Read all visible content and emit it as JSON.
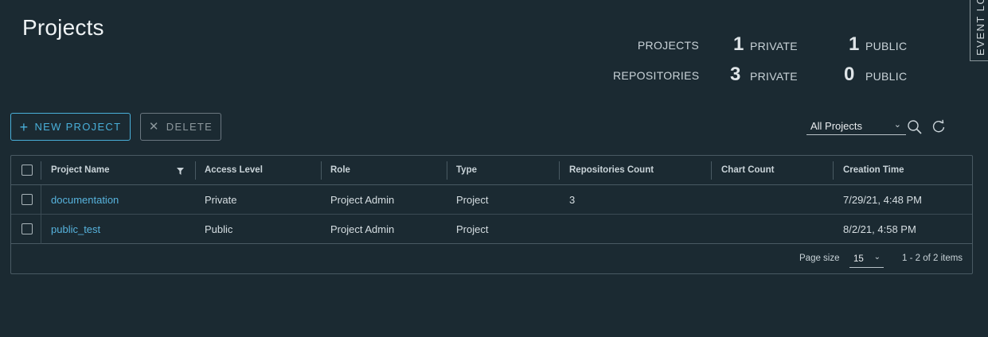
{
  "page": {
    "title": "Projects"
  },
  "stats": {
    "projects_label": "PROJECTS",
    "projects_private_count": "1",
    "projects_private_label": "PRIVATE",
    "projects_public_count": "1",
    "projects_public_label": "PUBLIC",
    "repos_label": "REPOSITORIES",
    "repos_private_count": "3",
    "repos_private_label": "PRIVATE",
    "repos_public_count": "0",
    "repos_public_label": "PUBLIC"
  },
  "event_log": {
    "label": "EVENT LOG"
  },
  "toolbar": {
    "new_project_label": "NEW PROJECT",
    "new_project_icon": "plus-icon",
    "delete_label": "DELETE",
    "delete_icon": "close-icon",
    "filter_value": "All Projects",
    "search_icon": "search-icon",
    "refresh_icon": "refresh-icon"
  },
  "table": {
    "columns": [
      "Project Name",
      "Access Level",
      "Role",
      "Type",
      "Repositories Count",
      "Chart Count",
      "Creation Time"
    ],
    "rows": [
      {
        "name": "documentation",
        "access": "Private",
        "role": "Project Admin",
        "type": "Project",
        "repos": "3",
        "charts": "",
        "created": "7/29/21, 4:48 PM"
      },
      {
        "name": "public_test",
        "access": "Public",
        "role": "Project Admin",
        "type": "Project",
        "repos": "",
        "charts": "",
        "created": "8/2/21, 4:58 PM"
      }
    ],
    "footer": {
      "page_size_label": "Page size",
      "page_size_value": "15",
      "range_text": "1 - 2 of 2 items"
    }
  },
  "colors": {
    "background": "#1b2a32",
    "accent": "#49afd9",
    "link": "#57b3dd",
    "border": "#495a63"
  }
}
